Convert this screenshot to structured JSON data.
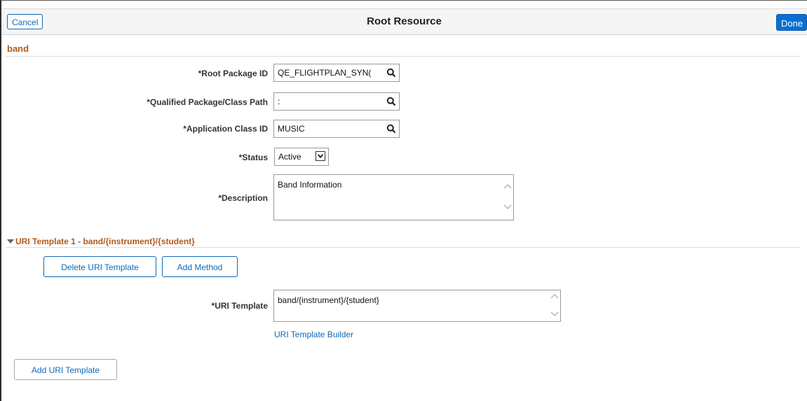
{
  "header": {
    "title": "Root Resource",
    "cancel_label": "Cancel",
    "done_label": "Done"
  },
  "section": {
    "title": "band"
  },
  "fields": {
    "root_package_id": {
      "label": "*Root Package ID",
      "value": "QE_FLIGHTPLAN_SYN("
    },
    "qualified_path": {
      "label": "*Qualified Package/Class Path",
      "value": ":"
    },
    "app_class_id": {
      "label": "*Application Class ID",
      "value": "MUSIC"
    },
    "status": {
      "label": "*Status",
      "value": "Active"
    },
    "description": {
      "label": "*Description",
      "value": "Band Information"
    }
  },
  "uri_group": {
    "title": "URI Template 1 - band/{instrument}/{student}",
    "delete_label": "Delete URI Template",
    "add_method_label": "Add Method",
    "uri_template": {
      "label": "*URI Template",
      "value": "band/{instrument}/{student}"
    },
    "builder_link": "URI Template Builder"
  },
  "add_uri_template_label": "Add URI Template",
  "icons": {
    "search": "search-icon",
    "dropdown": "chevron-down-icon",
    "collapse": "caret-down-icon"
  },
  "colors": {
    "accent_blue": "#0e69b6",
    "section_orange": "#b05a1a",
    "done_bg": "#0a6ed1"
  }
}
